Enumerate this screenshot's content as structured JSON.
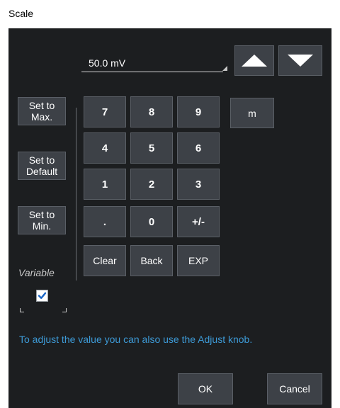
{
  "window": {
    "title": "Scale"
  },
  "field": {
    "value": "50.0 mV"
  },
  "side_buttons": [
    {
      "line1": "Set to",
      "line2": "Max."
    },
    {
      "line1": "Set to",
      "line2": "Default"
    },
    {
      "line1": "Set to",
      "line2": "Min."
    }
  ],
  "keypad": {
    "k7": "7",
    "k8": "8",
    "k9": "9",
    "k4": "4",
    "k5": "5",
    "k6": "6",
    "k1": "1",
    "k2": "2",
    "k3": "3",
    "kdot": ".",
    "k0": "0",
    "ksign": "+/-",
    "clear": "Clear",
    "back": "Back",
    "exp": "EXP",
    "unit": "m"
  },
  "variable": {
    "label": "Variable",
    "checked": true
  },
  "hint": "To adjust the value you can also use the Adjust knob.",
  "actions": {
    "ok": "OK",
    "cancel": "Cancel"
  },
  "icons": {
    "up": "arrow-up-icon",
    "down": "arrow-down-icon",
    "check": "checkmark-icon"
  },
  "colors": {
    "panel": "#1c1e20",
    "button": "#3d4147",
    "hint": "#3d9ad6",
    "check": "#1a66c7"
  }
}
